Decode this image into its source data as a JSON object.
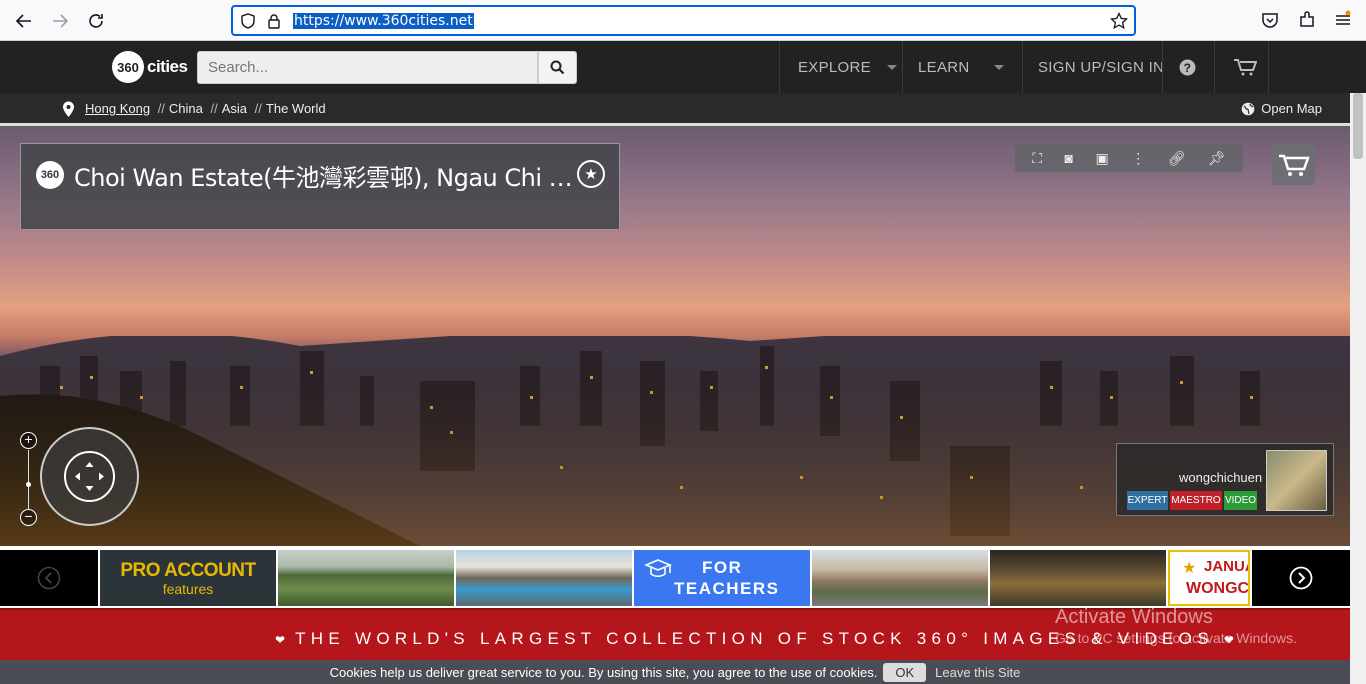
{
  "browser": {
    "url": "https://www.360cities.net"
  },
  "header": {
    "logo_mark": "360",
    "logo_text": "cities",
    "search_placeholder": "Search...",
    "menu": {
      "explore": "EXPLORE",
      "learn": "LEARN",
      "signin": "SIGN UP/SIGN IN"
    }
  },
  "breadcrumb": {
    "items": [
      "Hong Kong",
      "China",
      "Asia",
      "The World"
    ],
    "separator": "//",
    "open_map": "Open Map"
  },
  "panorama": {
    "badge": "360",
    "title": "Choi Wan Estate(牛池灣彩雲邨), Ngau Chi …",
    "author": "wongchichuen",
    "badges": [
      {
        "label": "EXPERT",
        "color": "#2f6fa0"
      },
      {
        "label": "MAESTRO",
        "color": "#c0202a"
      },
      {
        "label": "VIDEO",
        "color": "#2e9a3a"
      }
    ]
  },
  "strip": {
    "pro_title": "PRO ACCOUNT",
    "pro_sub": "features",
    "teach_line1": "FOR",
    "teach_line2": "TEACHERS",
    "janua_line1": "JANUA",
    "janua_line2": "WONGC"
  },
  "banner": {
    "text": "THE WORLD'S LARGEST COLLECTION OF STOCK 360° IMAGES & VIDEOS"
  },
  "watermark": {
    "line1": "Activate Windows",
    "line2": "Go to PC settings to activate Windows."
  },
  "cookie": {
    "text": "Cookies help us deliver great service to you. By using this site, you agree to the use of cookies.",
    "ok": "OK",
    "leave": "Leave this Site"
  },
  "colors": {
    "header_bg": "#222222",
    "banner_red": "#b4161b",
    "url_highlight": "#0a5ec4"
  }
}
